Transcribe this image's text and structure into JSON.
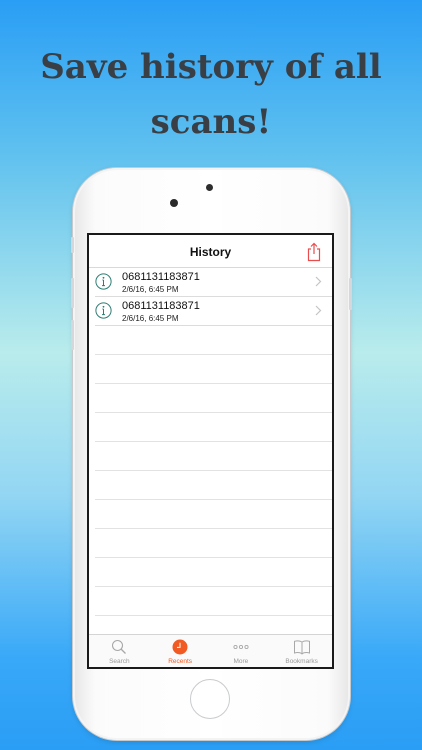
{
  "headline": {
    "line1": "Save history of all",
    "line2": "scans!"
  },
  "navbar": {
    "title": "History",
    "share_icon": "share-icon"
  },
  "history": [
    {
      "code": "0681131183871",
      "date": "2/6/16, 6:45 PM"
    },
    {
      "code": "0681131183871",
      "date": "2/6/16, 6:45 PM"
    }
  ],
  "tabs": [
    {
      "label": "Search",
      "icon": "magnifier-icon",
      "active": false
    },
    {
      "label": "Recents",
      "icon": "clock-icon",
      "active": true
    },
    {
      "label": "More",
      "icon": "ellipsis-icon",
      "active": false
    },
    {
      "label": "Bookmarks",
      "icon": "book-icon",
      "active": false
    }
  ],
  "colors": {
    "accent": "#f15a22",
    "share": "#ea4d4d",
    "info": "#2e7d73",
    "headline": "#3a3f45"
  }
}
